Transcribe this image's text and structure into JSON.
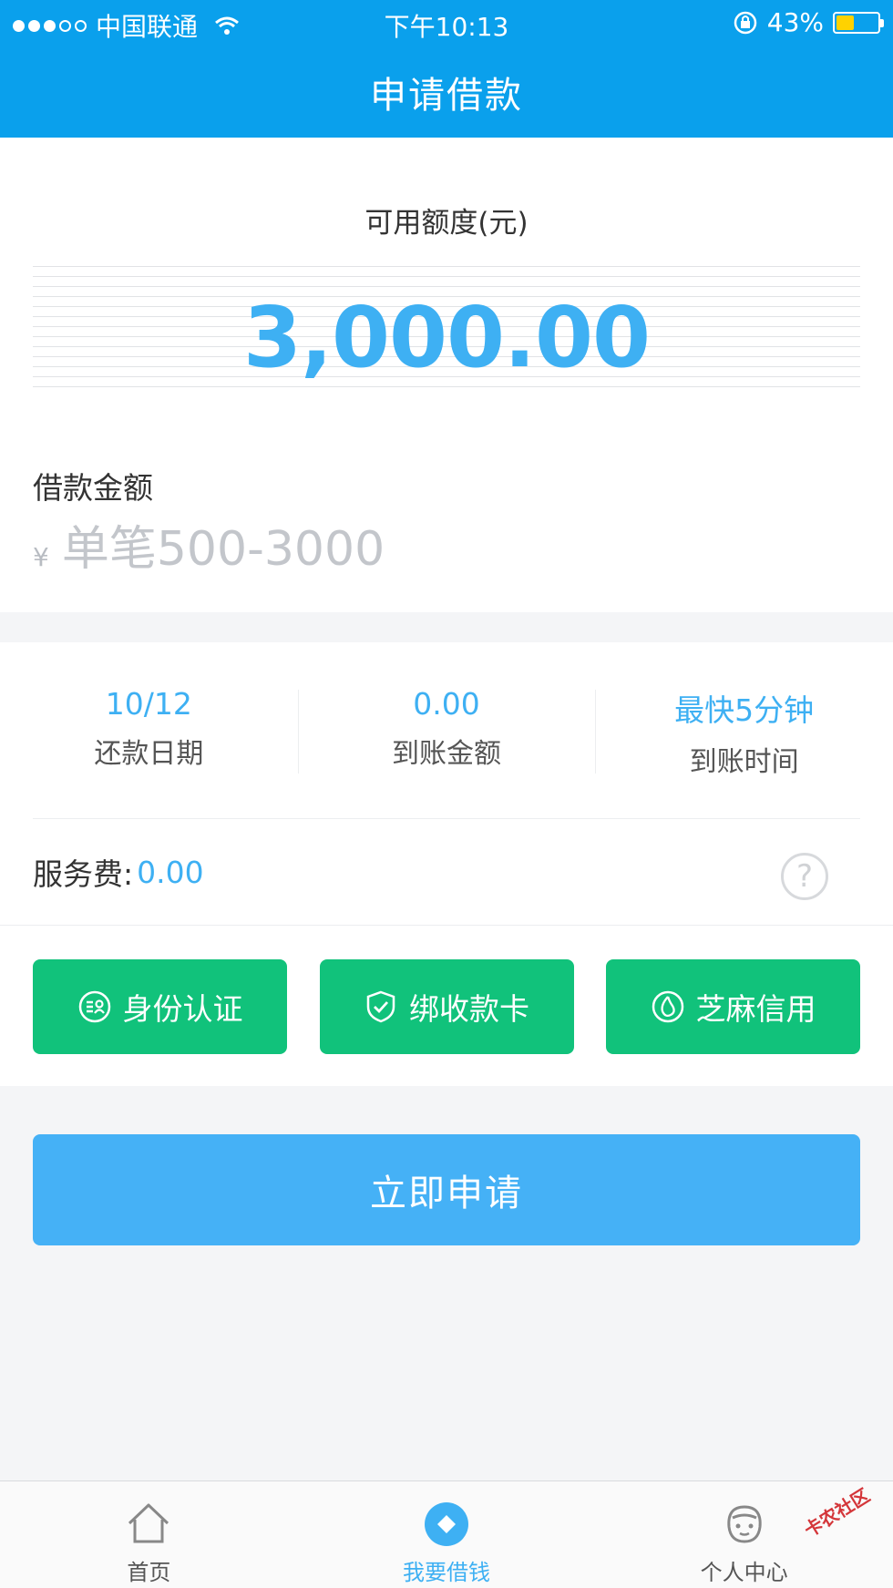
{
  "status_bar": {
    "carrier": "中国联通",
    "time": "下午10:13",
    "battery_percent": "43%",
    "battery_level": 0.43,
    "icons": [
      "signal-dots-icon",
      "wifi-icon",
      "rotation-lock-icon",
      "battery-icon"
    ]
  },
  "header": {
    "title": "申请借款",
    "color": "#0aa0ec"
  },
  "quota": {
    "label": "可用额度(元)",
    "value": "3,000.00"
  },
  "loan_amount": {
    "label": "借款金额",
    "currency": "¥",
    "placeholder": "单笔500-3000",
    "value": ""
  },
  "stats": [
    {
      "value": "10/12",
      "label": "还款日期"
    },
    {
      "value": "0.00",
      "label": "到账金额"
    },
    {
      "value": "最快5分钟",
      "label": "到账时间"
    }
  ],
  "fee": {
    "label": "服务费:",
    "value": "0.00",
    "help_icon": "question-circle-icon"
  },
  "verify_buttons": [
    {
      "label": "身份认证",
      "icon": "id-card-icon"
    },
    {
      "label": "绑收款卡",
      "icon": "shield-check-icon"
    },
    {
      "label": "芝麻信用",
      "icon": "sesame-credit-icon"
    }
  ],
  "apply_button": {
    "label": "立即申请",
    "color": "#45b1f6"
  },
  "tabbar": {
    "tabs": [
      {
        "label": "首页",
        "icon": "home-icon",
        "active": false
      },
      {
        "label": "我要借钱",
        "icon": "diamond-icon",
        "active": true
      },
      {
        "label": "个人中心",
        "icon": "profile-face-icon",
        "active": false
      }
    ]
  },
  "watermark": "卡农社区",
  "colors": {
    "accent_blue": "#3eb0f3",
    "green": "#11c27b",
    "battery_yellow": "#ffd200"
  }
}
